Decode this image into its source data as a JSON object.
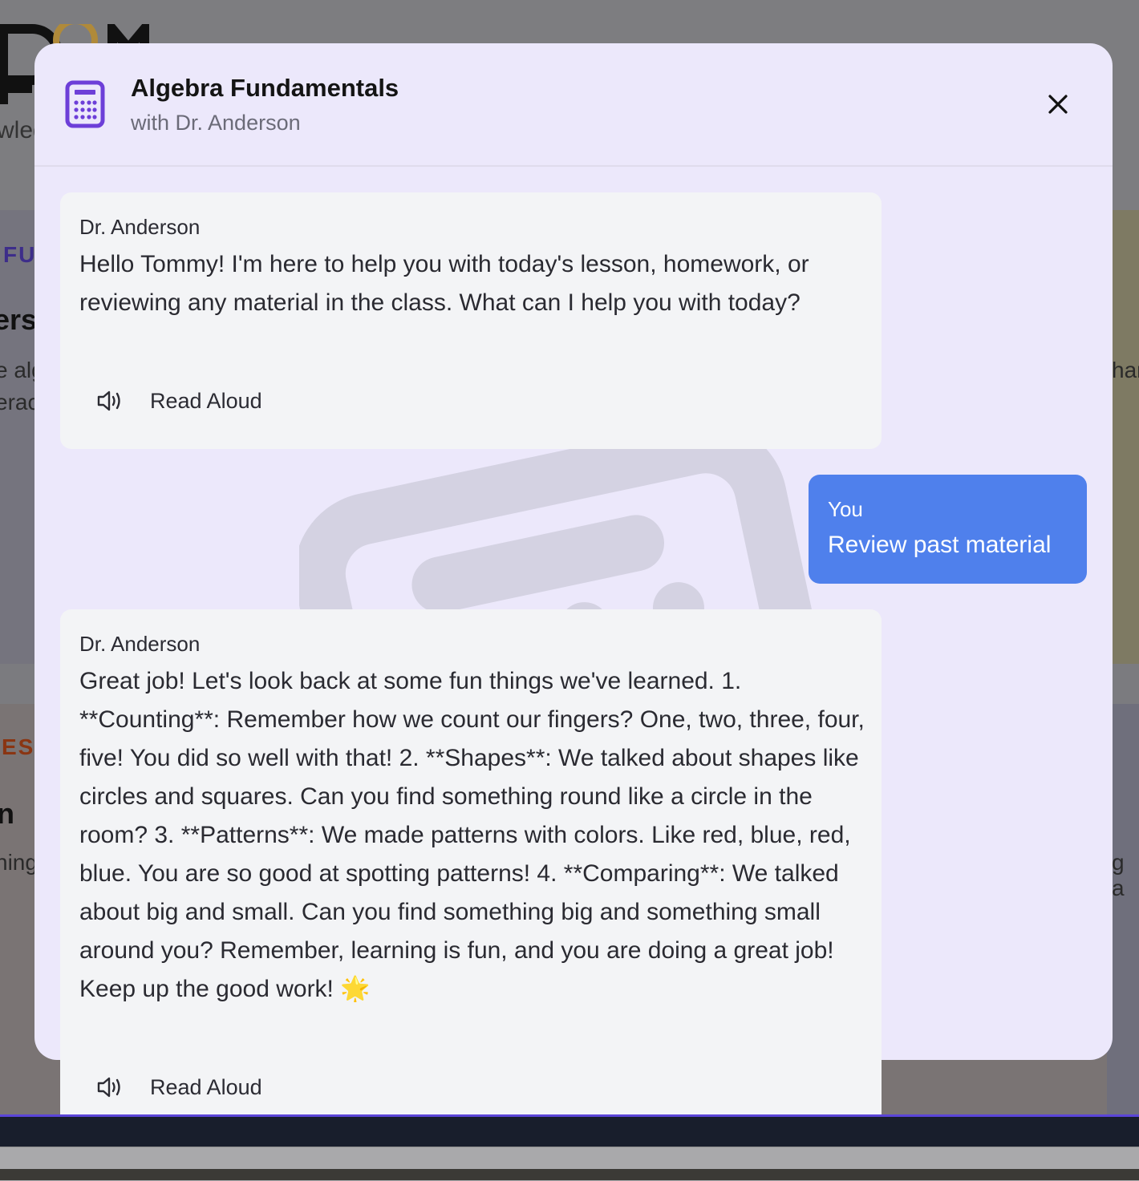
{
  "background": {
    "logo_text": "DOM",
    "subtitle_fragment": "wled",
    "card1": {
      "label": "FU",
      "title_fragment": "ers",
      "text_lines": [
        "e alg",
        "erac"
      ],
      "right_fragment": "har"
    },
    "card2": {
      "label": "ES",
      "title_fragment": "n",
      "text_lines": [
        "ning"
      ],
      "right_fragment": "g a"
    }
  },
  "modal": {
    "icon": "calculator-icon",
    "title": "Algebra Fundamentals",
    "subtitle": "with Dr. Anderson",
    "close_icon": "close-icon",
    "accent_color": "#6d3fd8"
  },
  "messages": [
    {
      "role": "assistant",
      "sender": "Dr. Anderson",
      "text": "Hello Tommy! I'm here to help you with today's lesson, homework, or reviewing any material in the class. What can I help you with today?",
      "action_label": "Read Aloud",
      "action_icon": "speaker-icon"
    },
    {
      "role": "user",
      "sender": "You",
      "text": "Review past material",
      "bubble_color": "#4f80ec"
    },
    {
      "role": "assistant",
      "sender": "Dr. Anderson",
      "text": "Great job! Let's look back at some fun things we've learned. 1. **Counting**: Remember how we count our fingers? One, two, three, four, five! You did so well with that! 2. **Shapes**: We talked about shapes like circles and squares. Can you find something round like a circle in the room? 3. **Patterns**: We made patterns with colors. Like red, blue, red, blue. You are so good at spotting patterns! 4. **Comparing**: We talked about big and small. Can you find something big and something small around you? Remember, learning is fun, and you are doing a great job! Keep up the good work! 🌟",
      "action_label": "Read Aloud",
      "action_icon": "speaker-icon"
    }
  ]
}
